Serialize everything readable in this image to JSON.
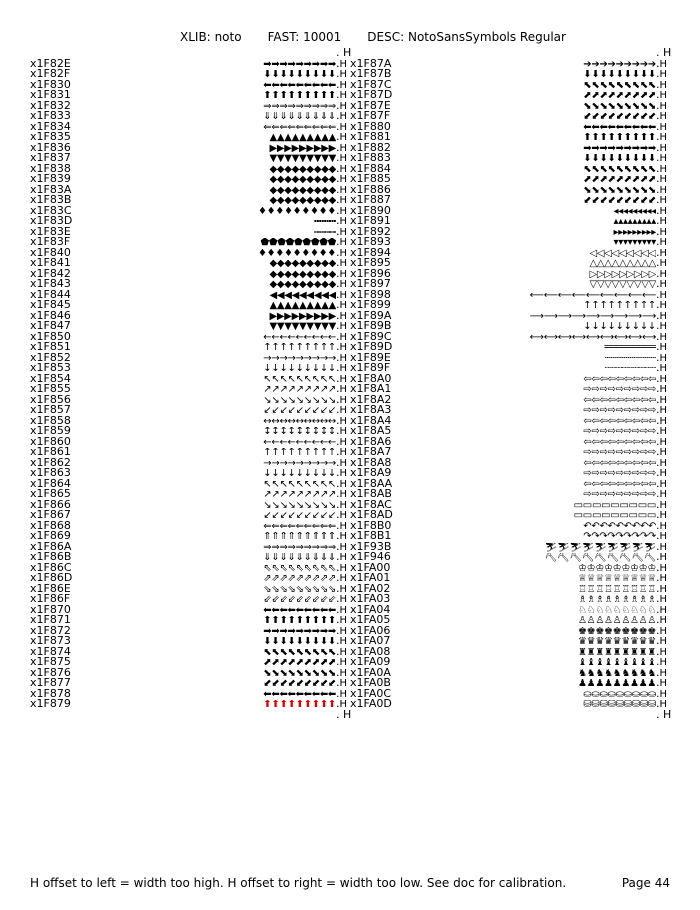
{
  "header": {
    "xlib_label": "XLIB:",
    "xlib_value": "noto",
    "fast_label": "FAST:",
    "fast_value": "10001",
    "desc_label": "DESC:",
    "desc_value": "NotoSansSymbols Regular"
  },
  "left": [
    {
      "code": "x1F82E",
      "g": "➡➡➡➡➡➡➡➡➡"
    },
    {
      "code": "x1F82F",
      "g": "⬇⬇⬇⬇⬇⬇⬇⬇⬇"
    },
    {
      "code": "x1F830",
      "g": "⬅⬅⬅⬅⬅⬅⬅⬅⬅"
    },
    {
      "code": "x1F831",
      "g": "⬆⬆⬆⬆⬆⬆⬆⬆⬆"
    },
    {
      "code": "x1F832",
      "g": "⇒⇒⇒⇒⇒⇒⇒⇒⇒"
    },
    {
      "code": "x1F833",
      "g": "⇓⇓⇓⇓⇓⇓⇓⇓⇓"
    },
    {
      "code": "x1F834",
      "g": "⇐⇐⇐⇐⇐⇐⇐⇐⇐"
    },
    {
      "code": "x1F835",
      "g": "▲▲▲▲▲▲▲▲▲"
    },
    {
      "code": "x1F836",
      "g": "▶▶▶▶▶▶▶▶▶"
    },
    {
      "code": "x1F837",
      "g": "▼▼▼▼▼▼▼▼▼"
    },
    {
      "code": "x1F838",
      "g": "◆◆◆◆◆◆◆◆◆"
    },
    {
      "code": "x1F839",
      "g": "◆◆◆◆◆◆◆◆◆"
    },
    {
      "code": "x1F83A",
      "g": "◆◆◆◆◆◆◆◆◆"
    },
    {
      "code": "x1F83B",
      "g": "◆◆◆◆◆◆◆◆◆"
    },
    {
      "code": "x1F83C",
      "g": "♦♦♦♦♦♦♦♦♦"
    },
    {
      "code": "x1F83D",
      "g": "⬝⬝⬝⬝⬝⬝⬝⬝⬝"
    },
    {
      "code": "x1F83E",
      "g": "⬞⬞⬞⬞⬞⬞⬞⬞⬞"
    },
    {
      "code": "x1F83F",
      "g": "⬟⬟⬟⬟⬟⬟⬟⬟⬟"
    },
    {
      "code": "x1F840",
      "g": "♦♦♦♦♦♦♦♦♦"
    },
    {
      "code": "x1F841",
      "g": "◆◆◆◆◆◆◆◆◆"
    },
    {
      "code": "x1F842",
      "g": "◆◆◆◆◆◆◆◆◆"
    },
    {
      "code": "x1F843",
      "g": "◆◆◆◆◆◆◆◆◆"
    },
    {
      "code": "x1F844",
      "g": "◀◀◀◀◀◀◀◀◀"
    },
    {
      "code": "x1F845",
      "g": "▲▲▲▲▲▲▲▲▲"
    },
    {
      "code": "x1F846",
      "g": "▶▶▶▶▶▶▶▶▶"
    },
    {
      "code": "x1F847",
      "g": "▼▼▼▼▼▼▼▼▼"
    },
    {
      "code": "x1F850",
      "g": "←←←←←←←←←"
    },
    {
      "code": "x1F851",
      "g": "↑↑↑↑↑↑↑↑↑"
    },
    {
      "code": "x1F852",
      "g": "→→→→→→→→→"
    },
    {
      "code": "x1F853",
      "g": "↓↓↓↓↓↓↓↓↓"
    },
    {
      "code": "x1F854",
      "g": "↖↖↖↖↖↖↖↖↖"
    },
    {
      "code": "x1F855",
      "g": "↗↗↗↗↗↗↗↗↗"
    },
    {
      "code": "x1F856",
      "g": "↘↘↘↘↘↘↘↘↘"
    },
    {
      "code": "x1F857",
      "g": "↙↙↙↙↙↙↙↙↙"
    },
    {
      "code": "x1F858",
      "g": "↔↔↔↔↔↔↔↔↔"
    },
    {
      "code": "x1F859",
      "g": "↕↕↕↕↕↕↕↕↕"
    },
    {
      "code": "x1F860",
      "g": "←←←←←←←←←"
    },
    {
      "code": "x1F861",
      "g": "↑↑↑↑↑↑↑↑↑"
    },
    {
      "code": "x1F862",
      "g": "→→→→→→→→→"
    },
    {
      "code": "x1F863",
      "g": "↓↓↓↓↓↓↓↓↓"
    },
    {
      "code": "x1F864",
      "g": "↖↖↖↖↖↖↖↖↖"
    },
    {
      "code": "x1F865",
      "g": "↗↗↗↗↗↗↗↗↗"
    },
    {
      "code": "x1F866",
      "g": "↘↘↘↘↘↘↘↘↘"
    },
    {
      "code": "x1F867",
      "g": "↙↙↙↙↙↙↙↙↙"
    },
    {
      "code": "x1F868",
      "g": "⇐⇐⇐⇐⇐⇐⇐⇐⇐"
    },
    {
      "code": "x1F869",
      "g": "⇑⇑⇑⇑⇑⇑⇑⇑⇑"
    },
    {
      "code": "x1F86A",
      "g": "⇒⇒⇒⇒⇒⇒⇒⇒⇒"
    },
    {
      "code": "x1F86B",
      "g": "⇓⇓⇓⇓⇓⇓⇓⇓⇓"
    },
    {
      "code": "x1F86C",
      "g": "⇖⇖⇖⇖⇖⇖⇖⇖⇖"
    },
    {
      "code": "x1F86D",
      "g": "⇗⇗⇗⇗⇗⇗⇗⇗⇗"
    },
    {
      "code": "x1F86E",
      "g": "⇘⇘⇘⇘⇘⇘⇘⇘⇘"
    },
    {
      "code": "x1F86F",
      "g": "⇙⇙⇙⇙⇙⇙⇙⇙⇙"
    },
    {
      "code": "x1F870",
      "g": "⬅⬅⬅⬅⬅⬅⬅⬅⬅"
    },
    {
      "code": "x1F871",
      "g": "⬆⬆⬆⬆⬆⬆⬆⬆⬆"
    },
    {
      "code": "x1F872",
      "g": "➡➡➡➡➡➡➡➡➡"
    },
    {
      "code": "x1F873",
      "g": "⬇⬇⬇⬇⬇⬇⬇⬇⬇"
    },
    {
      "code": "x1F874",
      "g": "⬉⬉⬉⬉⬉⬉⬉⬉⬉"
    },
    {
      "code": "x1F875",
      "g": "⬈⬈⬈⬈⬈⬈⬈⬈⬈"
    },
    {
      "code": "x1F876",
      "g": "⬊⬊⬊⬊⬊⬊⬊⬊⬊"
    },
    {
      "code": "x1F877",
      "g": "⬋⬋⬋⬋⬋⬋⬋⬋⬋"
    },
    {
      "code": "x1F878",
      "g": "⬅⬅⬅⬅⬅⬅⬅⬅⬅"
    },
    {
      "code": "x1F879",
      "g": "⬆⬆⬆⬆⬆⬆⬆⬆⬆",
      "red": true
    }
  ],
  "right": [
    {
      "code": "x1F87A",
      "g": "➔➔➔➔➔➔➔➔➔"
    },
    {
      "code": "x1F87B",
      "g": "⬇⬇⬇⬇⬇⬇⬇⬇⬇"
    },
    {
      "code": "x1F87C",
      "g": "⬉⬉⬉⬉⬉⬉⬉⬉⬉"
    },
    {
      "code": "x1F87D",
      "g": "⬈⬈⬈⬈⬈⬈⬈⬈⬈"
    },
    {
      "code": "x1F87E",
      "g": "⬊⬊⬊⬊⬊⬊⬊⬊⬊"
    },
    {
      "code": "x1F87F",
      "g": "⬋⬋⬋⬋⬋⬋⬋⬋⬋"
    },
    {
      "code": "x1F880",
      "g": "⬅⬅⬅⬅⬅⬅⬅⬅⬅"
    },
    {
      "code": "x1F881",
      "g": "⬆⬆⬆⬆⬆⬆⬆⬆⬆"
    },
    {
      "code": "x1F882",
      "g": "➡➡➡➡➡➡➡➡➡"
    },
    {
      "code": "x1F883",
      "g": "⬇⬇⬇⬇⬇⬇⬇⬇⬇"
    },
    {
      "code": "x1F884",
      "g": "⬉⬉⬉⬉⬉⬉⬉⬉⬉"
    },
    {
      "code": "x1F885",
      "g": "⬈⬈⬈⬈⬈⬈⬈⬈⬈"
    },
    {
      "code": "x1F886",
      "g": "⬊⬊⬊⬊⬊⬊⬊⬊⬊"
    },
    {
      "code": "x1F887",
      "g": "⬋⬋⬋⬋⬋⬋⬋⬋⬋"
    },
    {
      "code": "x1F890",
      "g": "◂◂◂◂◂◂◂◂◂"
    },
    {
      "code": "x1F891",
      "g": "▴▴▴▴▴▴▴▴▴"
    },
    {
      "code": "x1F892",
      "g": "▸▸▸▸▸▸▸▸▸"
    },
    {
      "code": "x1F893",
      "g": "▾▾▾▾▾▾▾▾▾"
    },
    {
      "code": "x1F894",
      "g": "◁◁◁◁◁◁◁◁◁"
    },
    {
      "code": "x1F895",
      "g": "△△△△△△△△△"
    },
    {
      "code": "x1F896",
      "g": "▷▷▷▷▷▷▷▷▷"
    },
    {
      "code": "x1F897",
      "g": "▽▽▽▽▽▽▽▽▽"
    },
    {
      "code": "x1F898",
      "g": "⟵⟵⟵⟵⟵⟵⟵⟵⟵"
    },
    {
      "code": "x1F899",
      "g": "↑↑↑↑↑↑↑↑↑"
    },
    {
      "code": "x1F89A",
      "g": "⟶⟶⟶⟶⟶⟶⟶⟶⟶"
    },
    {
      "code": "x1F89B",
      "g": "↓↓↓↓↓↓↓↓↓"
    },
    {
      "code": "x1F89C",
      "g": "⟷⟷⟷⟷⟷⟷⟷⟷⟷"
    },
    {
      "code": "x1F89D",
      "g": "═════════"
    },
    {
      "code": "x1F89E",
      "g": "┄┄┄┄┄┄┄┄┄"
    },
    {
      "code": "x1F89F",
      "g": "┈┈┈┈┈┈┈┈┈"
    },
    {
      "code": "x1F8A0",
      "g": "⇦⇦⇦⇦⇦⇦⇦⇦⇦"
    },
    {
      "code": "x1F8A1",
      "g": "⇨⇨⇨⇨⇨⇨⇨⇨⇨"
    },
    {
      "code": "x1F8A2",
      "g": "⇦⇦⇦⇦⇦⇦⇦⇦⇦"
    },
    {
      "code": "x1F8A3",
      "g": "⇨⇨⇨⇨⇨⇨⇨⇨⇨"
    },
    {
      "code": "x1F8A4",
      "g": "⇦⇦⇦⇦⇦⇦⇦⇦⇦"
    },
    {
      "code": "x1F8A5",
      "g": "⇨⇨⇨⇨⇨⇨⇨⇨⇨"
    },
    {
      "code": "x1F8A6",
      "g": "⇦⇦⇦⇦⇦⇦⇦⇦⇦"
    },
    {
      "code": "x1F8A7",
      "g": "⇨⇨⇨⇨⇨⇨⇨⇨⇨"
    },
    {
      "code": "x1F8A8",
      "g": "⇦⇦⇦⇦⇦⇦⇦⇦⇦"
    },
    {
      "code": "x1F8A9",
      "g": "⇨⇨⇨⇨⇨⇨⇨⇨⇨"
    },
    {
      "code": "x1F8AA",
      "g": "⇦⇦⇦⇦⇦⇦⇦⇦⇦"
    },
    {
      "code": "x1F8AB",
      "g": "⇨⇨⇨⇨⇨⇨⇨⇨⇨"
    },
    {
      "code": "x1F8AC",
      "g": "▭▭▭▭▭▭▭▭▭"
    },
    {
      "code": "x1F8AD",
      "g": "▭▭▭▭▭▭▭▭▭"
    },
    {
      "code": "x1F8B0",
      "g": "↶↶↶↶↶↶↶↶↶"
    },
    {
      "code": "x1F8B1",
      "g": "↷↷↷↷↷↷↷↷↷"
    },
    {
      "code": "x1F93B",
      "g": "⛷⛷⛷⛷⛷⛷⛷⛷⛷"
    },
    {
      "code": "x1F946",
      "g": "⛏⛏⛏⛏⛏⛏⛏⛏⛏"
    },
    {
      "code": "x1FA00",
      "g": "♔♔♔♔♔♔♔♔♔"
    },
    {
      "code": "x1FA01",
      "g": "♕♕♕♕♕♕♕♕♕"
    },
    {
      "code": "x1FA02",
      "g": "♖♖♖♖♖♖♖♖♖"
    },
    {
      "code": "x1FA03",
      "g": "♗♗♗♗♗♗♗♗♗"
    },
    {
      "code": "x1FA04",
      "g": "♘♘♘♘♘♘♘♘♘"
    },
    {
      "code": "x1FA05",
      "g": "♙♙♙♙♙♙♙♙♙"
    },
    {
      "code": "x1FA06",
      "g": "♚♚♚♚♚♚♚♚♚"
    },
    {
      "code": "x1FA07",
      "g": "♛♛♛♛♛♛♛♛♛"
    },
    {
      "code": "x1FA08",
      "g": "♜♜♜♜♜♜♜♜♜"
    },
    {
      "code": "x1FA09",
      "g": "♝♝♝♝♝♝♝♝♝"
    },
    {
      "code": "x1FA0A",
      "g": "♞♞♞♞♞♞♞♞♞"
    },
    {
      "code": "x1FA0B",
      "g": "♟♟♟♟♟♟♟♟♟"
    },
    {
      "code": "x1FA0C",
      "g": "⛀⛀⛀⛀⛀⛀⛀⛀⛀"
    },
    {
      "code": "x1FA0D",
      "g": "⛁⛁⛁⛁⛁⛁⛁⛁⛁"
    }
  ],
  "footer": {
    "note": "H offset to left = width too high. H offset to right = width too low. See doc for calibration.",
    "page": "Page 44"
  }
}
